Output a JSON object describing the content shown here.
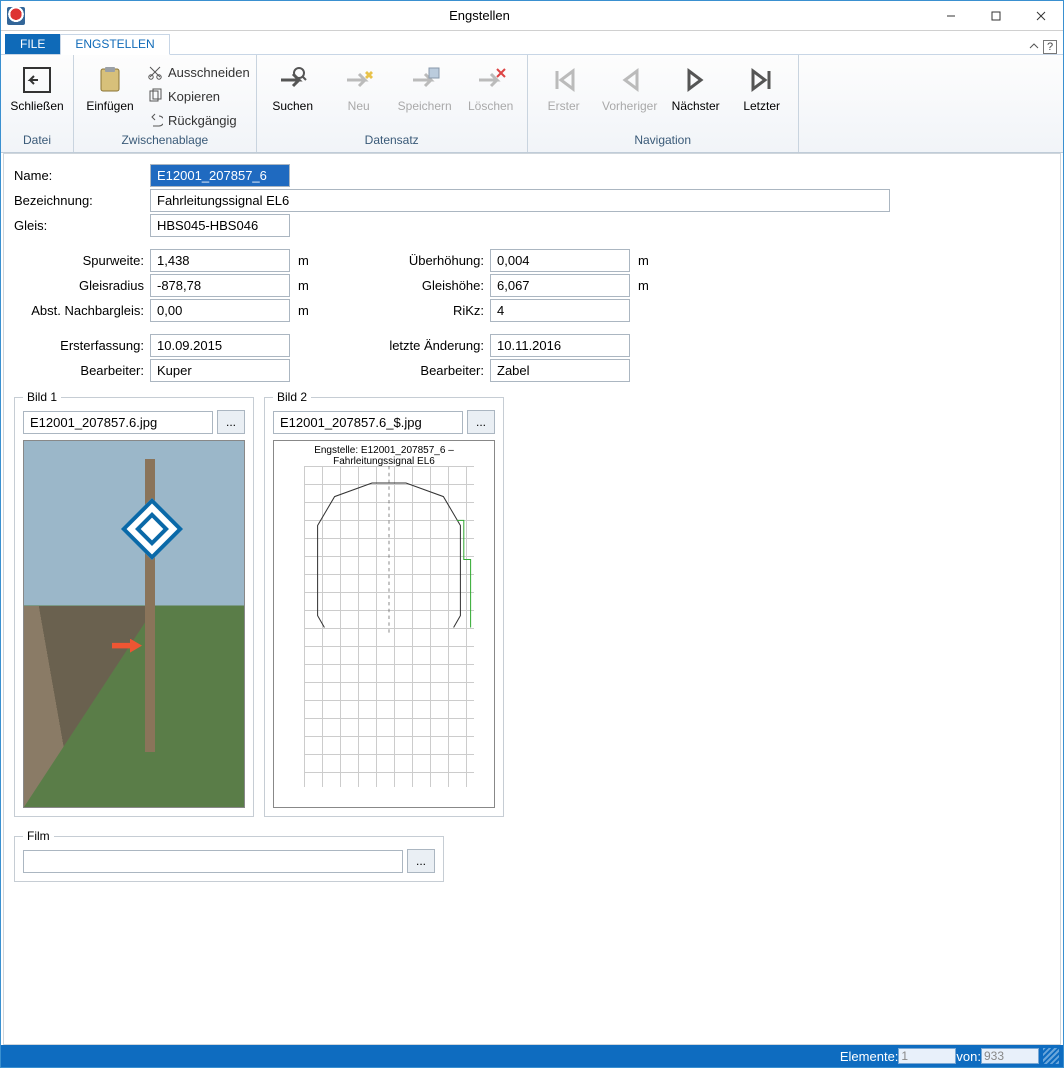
{
  "window": {
    "title": "Engstellen"
  },
  "tabs": {
    "file": "FILE",
    "active": "ENGSTELLEN"
  },
  "ribbon": {
    "datei": {
      "group": "Datei",
      "close": "Schließen"
    },
    "clipboard": {
      "group": "Zwischenablage",
      "paste": "Einfügen",
      "cut": "Ausschneiden",
      "copy": "Kopieren",
      "undo": "Rückgängig"
    },
    "record": {
      "group": "Datensatz",
      "search": "Suchen",
      "new": "Neu",
      "save": "Speichern",
      "delete": "Löschen"
    },
    "nav": {
      "group": "Navigation",
      "first": "Erster",
      "prev": "Vorheriger",
      "next": "Nächster",
      "last": "Letzter"
    }
  },
  "form": {
    "labels": {
      "name": "Name:",
      "bez": "Bezeichnung:",
      "gleis": "Gleis:",
      "spurweite": "Spurweite:",
      "gleisradius": "Gleisradius",
      "abst": "Abst. Nachbargleis:",
      "ersterfassung": "Ersterfassung:",
      "bearbeiter": "Bearbeiter:",
      "ueberhoehung": "Überhöhung:",
      "gleishoehe": "Gleishöhe:",
      "rikz": "RiKz:",
      "letzte": "letzte Änderung:",
      "bearbeiter2": "Bearbeiter:",
      "m": "m"
    },
    "values": {
      "name": "E12001_207857_6",
      "bez": "Fahrleitungssignal EL6",
      "gleis": "HBS045-HBS046",
      "spurweite": "1,438",
      "gleisradius": "-878,78",
      "abst": "0,00",
      "ersterfassung": "10.09.2015",
      "bearbeiter": "Kuper",
      "ueberhoehung": "0,004",
      "gleishoehe": "6,067",
      "rikz": "4",
      "letzte": "10.11.2016",
      "bearbeiter2": "Zabel"
    }
  },
  "bild1": {
    "legend": "Bild 1",
    "file": "E12001_207857.6.jpg"
  },
  "bild2": {
    "legend": "Bild 2",
    "file": "E12001_207857.6_$.jpg",
    "title": "Engstelle: E12001_207857_6 – Fahrleitungssignal EL6"
  },
  "film": {
    "legend": "Film",
    "file": ""
  },
  "status": {
    "elemente_lbl": "Elemente:",
    "elemente_val": "1",
    "von_lbl": "von:",
    "von_val": "933"
  }
}
